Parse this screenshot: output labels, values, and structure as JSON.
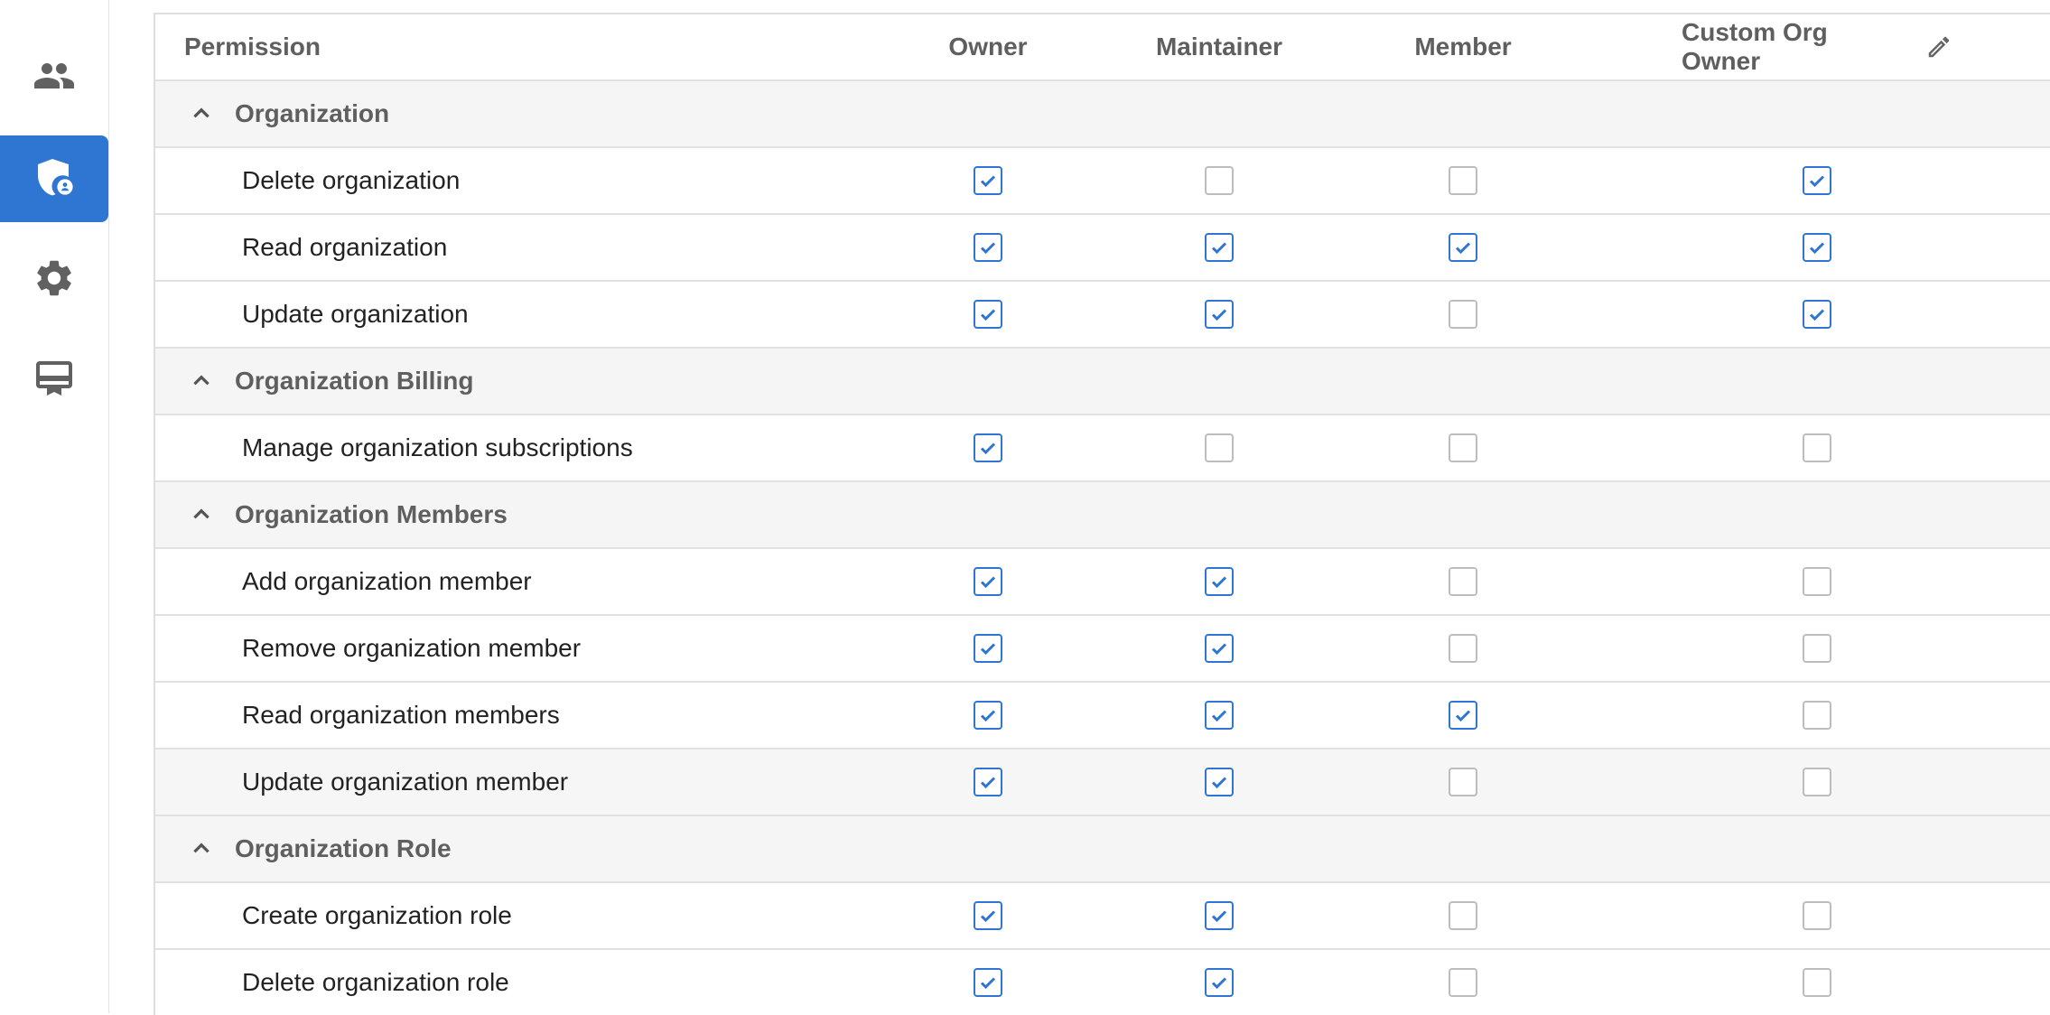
{
  "sidebar": {
    "items": [
      {
        "icon": "people-icon",
        "active": false
      },
      {
        "icon": "shield-user-icon",
        "active": true
      },
      {
        "icon": "gear-icon",
        "active": false
      },
      {
        "icon": "billing-icon",
        "active": false
      }
    ],
    "accent": "#2f76d2"
  },
  "table": {
    "columns": [
      "Permission",
      "Owner",
      "Maintainer",
      "Member",
      "Custom Org Owner"
    ],
    "groups": [
      {
        "label": "Organization",
        "rows": [
          {
            "label": "Delete organization",
            "values": [
              true,
              false,
              false,
              true
            ]
          },
          {
            "label": "Read organization",
            "values": [
              true,
              true,
              true,
              true
            ]
          },
          {
            "label": "Update organization",
            "values": [
              true,
              true,
              false,
              true
            ]
          }
        ]
      },
      {
        "label": "Organization Billing",
        "rows": [
          {
            "label": "Manage organization subscriptions",
            "values": [
              true,
              false,
              false,
              false
            ]
          }
        ]
      },
      {
        "label": "Organization Members",
        "rows": [
          {
            "label": "Add organization member",
            "values": [
              true,
              true,
              false,
              false
            ]
          },
          {
            "label": "Remove organization member",
            "values": [
              true,
              true,
              false,
              false
            ]
          },
          {
            "label": "Read organization members",
            "values": [
              true,
              true,
              true,
              false
            ]
          },
          {
            "label": "Update organization member",
            "values": [
              true,
              true,
              false,
              false
            ],
            "hovered": true
          }
        ]
      },
      {
        "label": "Organization Role",
        "rows": [
          {
            "label": "Create organization role",
            "values": [
              true,
              true,
              false,
              false
            ]
          },
          {
            "label": "Delete organization role",
            "values": [
              true,
              true,
              false,
              false
            ]
          }
        ]
      }
    ]
  }
}
